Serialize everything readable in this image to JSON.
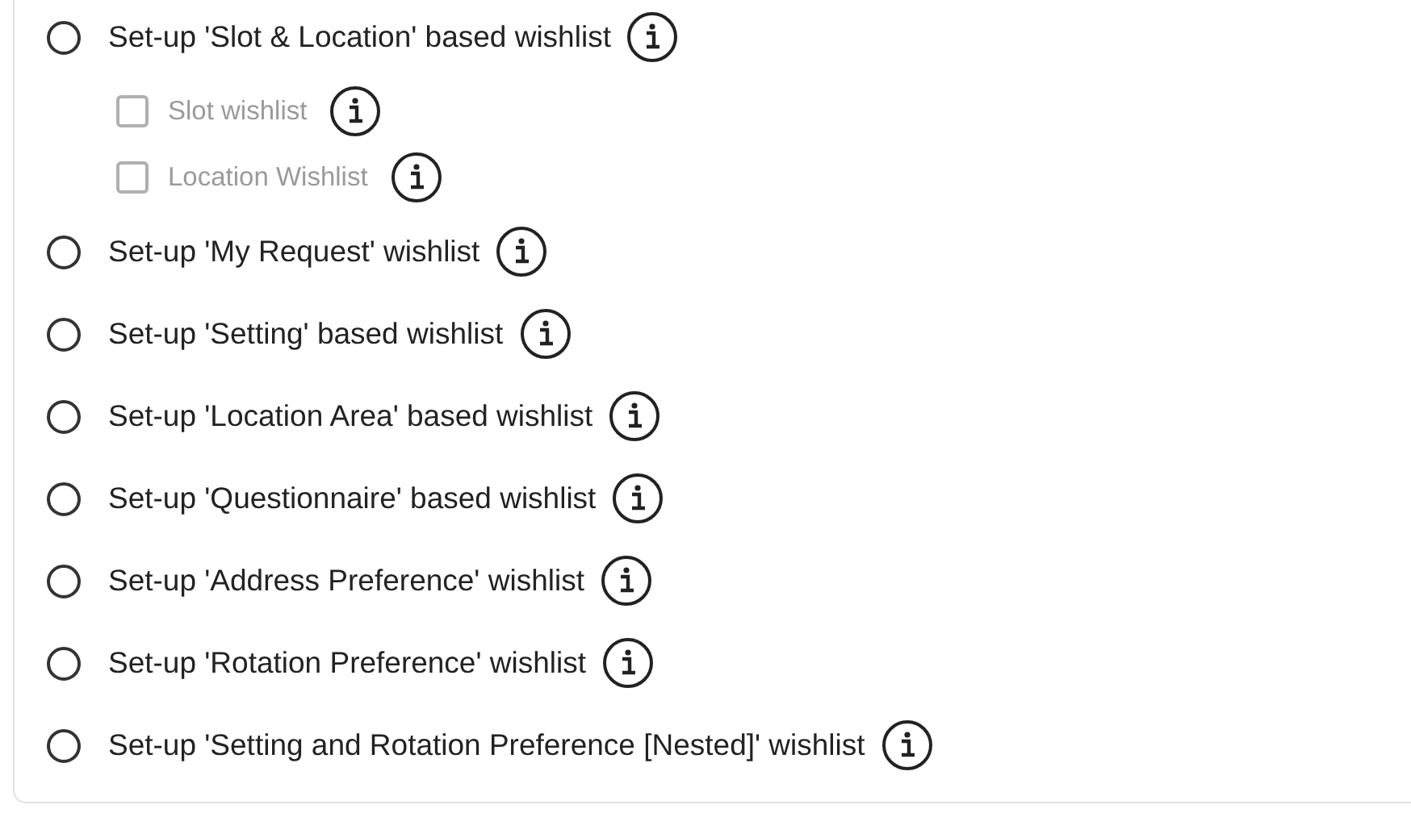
{
  "options": [
    {
      "label": "Set-up 'Slot & Location' based wishlist",
      "selected": false,
      "children": [
        {
          "label": "Slot wishlist",
          "checked": false,
          "disabled": true
        },
        {
          "label": "Location Wishlist",
          "checked": false,
          "disabled": true
        }
      ]
    },
    {
      "label": "Set-up 'My Request' wishlist",
      "selected": false
    },
    {
      "label": "Set-up 'Setting' based wishlist",
      "selected": false
    },
    {
      "label": "Set-up 'Location Area' based wishlist",
      "selected": false
    },
    {
      "label": "Set-up 'Questionnaire' based wishlist",
      "selected": false
    },
    {
      "label": "Set-up 'Address Preference' wishlist",
      "selected": false
    },
    {
      "label": "Set-up 'Rotation Preference' wishlist",
      "selected": false
    },
    {
      "label": "Set-up 'Setting and Rotation Preference [Nested]' wishlist",
      "selected": false
    }
  ]
}
